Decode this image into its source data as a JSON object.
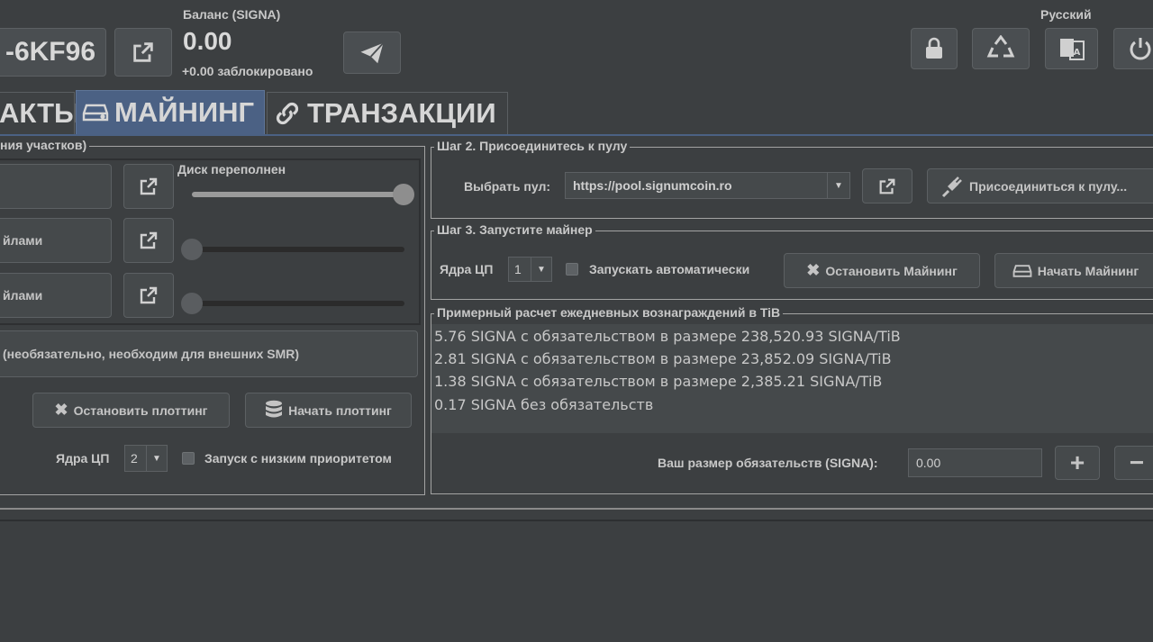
{
  "header": {
    "account_id": "-6KF96",
    "balance_label": "Баланс (SIGNA)",
    "balance_value": "0.00",
    "locked_text": "+0.00 заблокировано",
    "language": "Русский"
  },
  "tabs": [
    {
      "label": "АКТЫ",
      "icon": "contacts-icon"
    },
    {
      "label": "МАЙНИНГ",
      "icon": "hard-drive-icon",
      "active": true
    },
    {
      "label": "ТРАНЗАКЦИИ",
      "icon": "link-icon"
    }
  ],
  "plotting": {
    "group_title": "ния участков)",
    "disk_full_label": "Диск переполнен",
    "rows": [
      {
        "label": ""
      },
      {
        "label": "йлами"
      },
      {
        "label": "йлами"
      }
    ],
    "slider_levels": [
      1.0,
      0.0,
      0.0
    ],
    "optional_label": "(необязательно, необходим для внешних SMR)",
    "stop_button": "Остановить плоттинг",
    "start_button": "Начать плоттинг",
    "cores_label": "Ядра ЦП",
    "cores_value": "2",
    "low_priority_label": "Запуск с низким приоритетом"
  },
  "pool": {
    "group_title": "Шаг 2. Присоединитесь к пулу",
    "select_label": "Выбрать пул:",
    "pool_url": "https://pool.signumcoin.ro",
    "join_button": "Присоединиться к пулу..."
  },
  "miner": {
    "group_title": "Шаг 3. Запустите майнер",
    "cores_label": "Ядра ЦП",
    "cores_value": "1",
    "autostart_label": "Запускать автоматически",
    "stop_button": "Остановить Майнинг",
    "start_button": "Начать Майнинг"
  },
  "rewards": {
    "group_title": "Примерный расчет ежедневных вознаграждений в TiB",
    "lines": [
      "5.76 SIGNA с обязательством в размере 238,520.93 SIGNA/TiB",
      "2.81 SIGNA с обязательством в размере 23,852.09 SIGNA/TiB",
      "1.38 SIGNA с обязательством в размере 2,385.21 SIGNA/TiB",
      "0.17 SIGNA без обязательств"
    ],
    "commitment_label": "Ваш размер обязательств (SIGNA):",
    "commitment_value": "0.00"
  },
  "colors": {
    "background": "#3c3f41",
    "active_tab": "#4b6184",
    "border": "#a3a3a3"
  }
}
